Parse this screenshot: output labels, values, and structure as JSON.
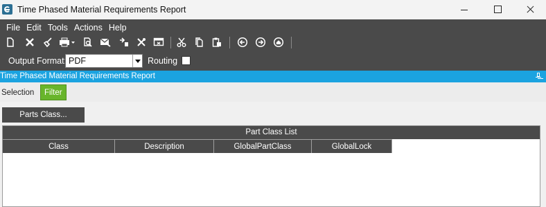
{
  "window": {
    "title": "Time Phased Material Requirements Report"
  },
  "menu": {
    "items": [
      {
        "label": "File"
      },
      {
        "label": "Edit"
      },
      {
        "label": "Tools"
      },
      {
        "label": "Actions"
      },
      {
        "label": "Help"
      }
    ]
  },
  "toolbar": {
    "icons": [
      "new-icon",
      "delete-icon",
      "clear-icon",
      "print-icon",
      "print-preview-icon",
      "email-icon",
      "attach-icon",
      "tools-icon",
      "screen-icon",
      "cut-icon",
      "copy-icon",
      "paste-icon",
      "back-icon",
      "forward-icon",
      "home-icon"
    ]
  },
  "options": {
    "output_format_label": "Output Format:",
    "output_format_value": "PDF",
    "routing_label": "Routing",
    "routing_checked": false
  },
  "panel": {
    "title": "Time Phased Material Requirements Report"
  },
  "tabs": [
    {
      "label": "Selection",
      "active": false
    },
    {
      "label": "Filter",
      "active": true
    }
  ],
  "filter": {
    "parts_class_button": "Parts Class...",
    "grid_caption": "Part Class List",
    "columns": [
      "Class",
      "Description",
      "GlobalPartClass",
      "GlobalLock"
    ]
  },
  "colors": {
    "header_dark": "#4a4a4a",
    "panel_header": "#1ba3e0",
    "active_tab": "#68b52b"
  }
}
